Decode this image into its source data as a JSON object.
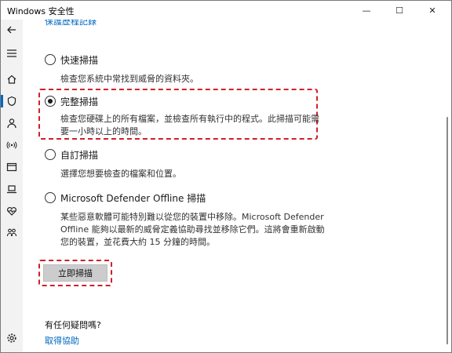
{
  "window": {
    "title": "Windows 安全性",
    "min_glyph": "—",
    "max_glyph": "☐",
    "close_glyph": "✕"
  },
  "sidebar": {
    "items": [
      {
        "name": "back-arrow-icon"
      },
      {
        "name": "hamburger-menu-icon"
      },
      {
        "name": "home-icon"
      },
      {
        "name": "shield-icon",
        "active": true
      },
      {
        "name": "account-person-icon"
      },
      {
        "name": "network-wireless-icon"
      },
      {
        "name": "app-browser-icon"
      },
      {
        "name": "device-security-icon"
      },
      {
        "name": "device-health-heart-icon"
      },
      {
        "name": "family-icon"
      },
      {
        "name": "settings-gear-icon"
      }
    ]
  },
  "main": {
    "partial_link": "保護歷程記錄",
    "options": [
      {
        "label": "快速掃描",
        "desc": "檢查您系統中常找到威脅的資料夾。",
        "checked": false
      },
      {
        "label": "完整掃描",
        "desc": "檢查您硬碟上的所有檔案，並檢查所有執行中的程式。此掃描可能需要一小時以上的時間。",
        "checked": true
      },
      {
        "label": "自訂掃描",
        "desc": "選擇您想要檢查的檔案和位置。",
        "checked": false
      },
      {
        "label": "Microsoft Defender Offline 掃描",
        "desc": "某些惡意軟體可能特別難以從您的裝置中移除。Microsoft Defender Offline 能夠以最新的威脅定義協助尋找並移除它們。這將會重新啟動您的裝置，並花費大約 15 分鐘的時間。",
        "checked": false
      }
    ],
    "scan_button": "立即掃描",
    "faq_title": "有任何疑問嗎?",
    "help_link": "取得協助"
  },
  "colors": {
    "accent": "#0067c0",
    "highlight": "#d0202a"
  }
}
